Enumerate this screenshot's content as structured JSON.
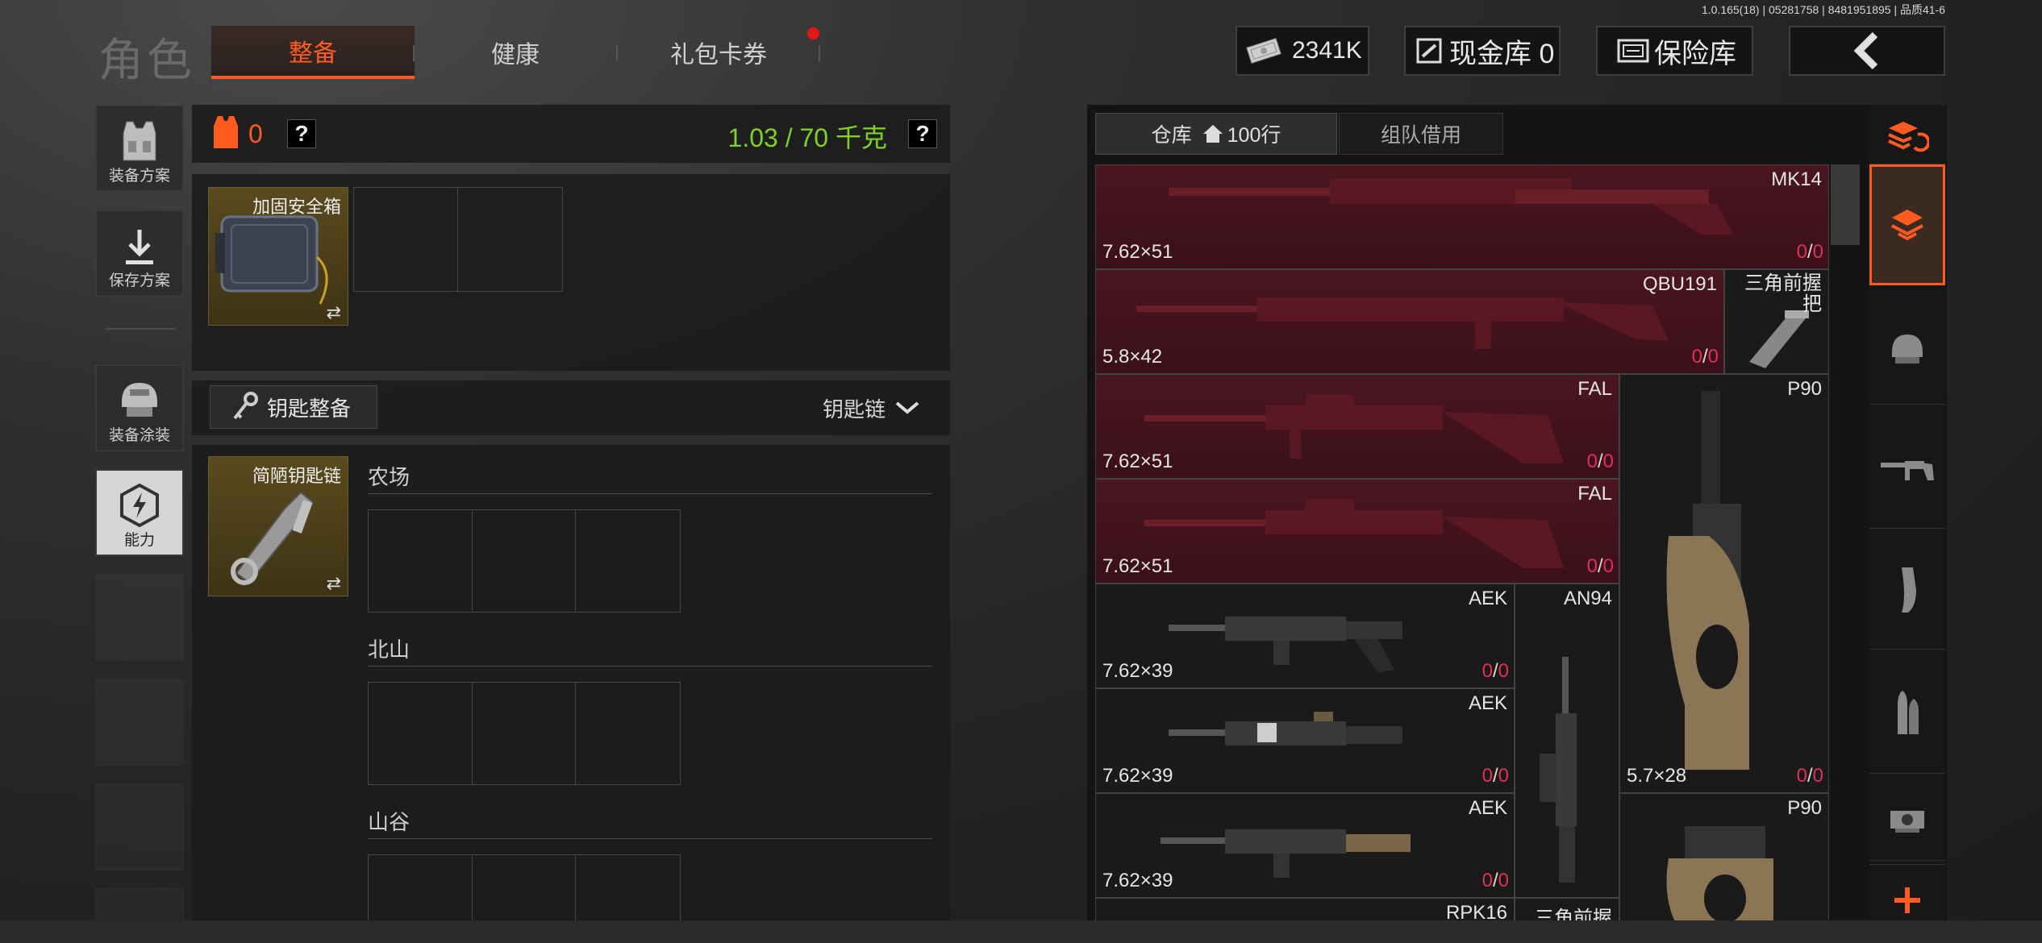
{
  "version": "1.0.165(18) | 05281758 | 8481951895 | 品质41-6",
  "page_title": "角色",
  "tabs": [
    {
      "label": "整备",
      "active": true
    },
    {
      "label": "健康",
      "active": false
    },
    {
      "label": "礼包卡券",
      "active": false,
      "badge": true
    }
  ],
  "currency": {
    "money": "2341K",
    "cash_vault": "现金库 0",
    "insurance": "保险库"
  },
  "sidebar": [
    {
      "label": "装备方案",
      "icon": "vest-icon"
    },
    {
      "label": "保存方案",
      "icon": "download-icon"
    },
    {
      "label": "装备涂装",
      "icon": "helmet-icon"
    },
    {
      "label": "能力",
      "icon": "ability-icon"
    }
  ],
  "loadout": {
    "armor_count": "0",
    "weight": "1.03 / 70 千克",
    "help": "?"
  },
  "safe_box": {
    "label": "加固安全箱"
  },
  "keys": {
    "button": "钥匙整备",
    "dropdown": "钥匙链",
    "keychain_label": "简陋钥匙链",
    "areas": [
      "农场",
      "北山",
      "山谷"
    ]
  },
  "storage": {
    "tab_storage": "仓库",
    "tab_rows": "100行",
    "tab_team": "组队借用",
    "items": [
      {
        "name": "MK14",
        "caliber": "7.62×51",
        "count_a": "0",
        "count_b": "0",
        "red": true
      },
      {
        "name": "QBU191",
        "caliber": "5.8×42",
        "count_a": "0",
        "count_b": "0",
        "red": true
      },
      {
        "name": "三角前握把",
        "caliber": "",
        "count_a": "",
        "count_b": "",
        "red": false
      },
      {
        "name": "FAL",
        "caliber": "7.62×51",
        "count_a": "0",
        "count_b": "0",
        "red": true
      },
      {
        "name": "FAL",
        "caliber": "7.62×51",
        "count_a": "0",
        "count_b": "0",
        "red": true
      },
      {
        "name": "P90",
        "caliber": "5.7×28",
        "count_a": "0",
        "count_b": "0",
        "red": false
      },
      {
        "name": "AEK",
        "caliber": "7.62×39",
        "count_a": "0",
        "count_b": "0",
        "red": false
      },
      {
        "name": "AN94",
        "caliber": "",
        "count_a": "",
        "count_b": "",
        "red": false
      },
      {
        "name": "AEK",
        "caliber": "7.62×39",
        "count_a": "0",
        "count_b": "0",
        "red": false
      },
      {
        "name": "AEK",
        "caliber": "7.62×39",
        "count_a": "0",
        "count_b": "0",
        "red": false
      },
      {
        "name": "P90",
        "caliber": "",
        "count_a": "",
        "count_b": "",
        "red": false
      },
      {
        "name": "RPK16",
        "caliber": "",
        "count_a": "",
        "count_b": "",
        "red": false
      },
      {
        "name": "三角前握",
        "caliber": "",
        "count_a": "",
        "count_b": "",
        "red": false
      }
    ],
    "slash": "/"
  },
  "right_tabs": [
    "layers-refresh-icon",
    "stack-icon",
    "helmet-icon",
    "rifle-icon",
    "magazine-icon",
    "ammo-icon",
    "scope-icon",
    "plus-icon"
  ],
  "colors": {
    "accent": "#ff5a1f",
    "weight_green": "#7ed321",
    "count_red": "#e0305a",
    "badge_red": "#e31919"
  }
}
